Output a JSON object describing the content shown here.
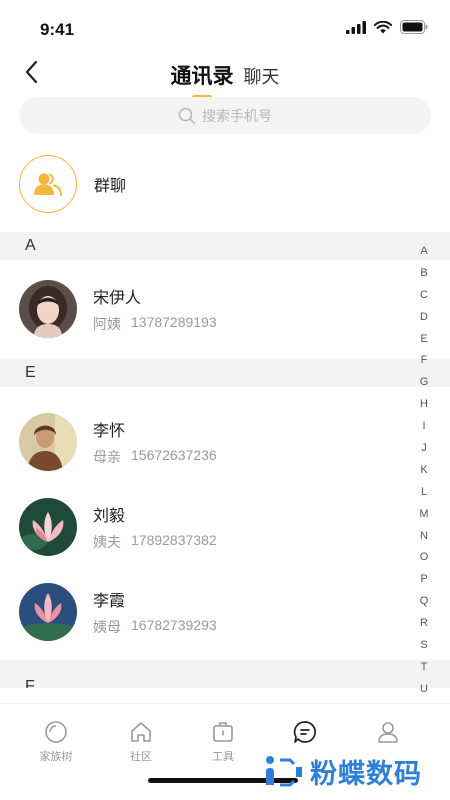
{
  "status": {
    "time": "9:41"
  },
  "header": {
    "active_tab": "通讯录",
    "other_tab": "聊天"
  },
  "search": {
    "placeholder": "搜索手机号"
  },
  "group": {
    "label": "群聊"
  },
  "sections": [
    {
      "letter": "A",
      "contacts": [
        {
          "name": "宋伊人",
          "relation": "阿姨",
          "phone": "13787289193"
        }
      ]
    },
    {
      "letter": "E",
      "contacts": [
        {
          "name": "李怀",
          "relation": "母亲",
          "phone": "15672637236"
        },
        {
          "name": "刘毅",
          "relation": "姨夫",
          "phone": "17892837382"
        },
        {
          "name": "李霞",
          "relation": "姨母",
          "phone": "16782739293"
        }
      ]
    },
    {
      "letter": "F",
      "contacts": []
    }
  ],
  "alphabet": [
    "A",
    "B",
    "C",
    "D",
    "E",
    "F",
    "G",
    "H",
    "I",
    "J",
    "K",
    "L",
    "M",
    "N",
    "O",
    "P",
    "Q",
    "R",
    "S",
    "T",
    "U"
  ],
  "tabbar": {
    "items": [
      {
        "label": "家族树",
        "icon": "circle-icon"
      },
      {
        "label": "社区",
        "icon": "home-icon"
      },
      {
        "label": "工具",
        "icon": "toolbox-icon"
      },
      {
        "label": "",
        "icon": "chat-bubble-icon"
      },
      {
        "label": "",
        "icon": "person-icon"
      }
    ]
  },
  "watermark": {
    "text": "粉蝶数码"
  },
  "colors": {
    "accent": "#F5B83D",
    "section_bg": "#F2F2F2",
    "secondary_text": "#9A9A9A",
    "watermark": "#2F7FD9"
  }
}
